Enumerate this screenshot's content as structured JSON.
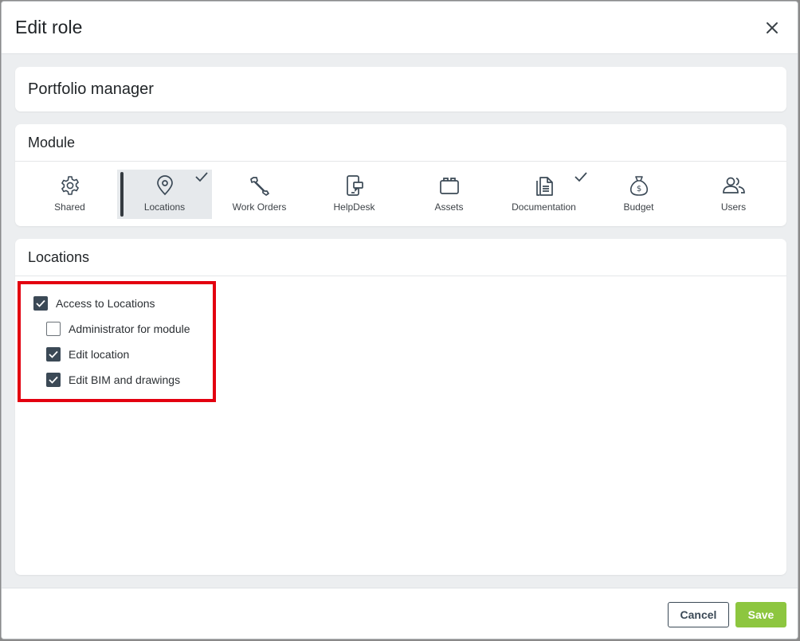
{
  "dialog": {
    "title": "Edit role",
    "close_icon": "close-icon"
  },
  "role": {
    "name": "Portfolio manager"
  },
  "module_section": {
    "title": "Module",
    "tabs": [
      {
        "label": "Shared",
        "icon": "gear-icon",
        "active": false,
        "has_access": false
      },
      {
        "label": "Locations",
        "icon": "location-pin-icon",
        "active": true,
        "has_access": true
      },
      {
        "label": "Work Orders",
        "icon": "wrench-icon",
        "active": false,
        "has_access": false
      },
      {
        "label": "HelpDesk",
        "icon": "phone-message-icon",
        "active": false,
        "has_access": false
      },
      {
        "label": "Assets",
        "icon": "assets-icon",
        "active": false,
        "has_access": false
      },
      {
        "label": "Documentation",
        "icon": "document-icon",
        "active": false,
        "has_access": true
      },
      {
        "label": "Budget",
        "icon": "money-bag-icon",
        "active": false,
        "has_access": false
      },
      {
        "label": "Users",
        "icon": "users-icon",
        "active": false,
        "has_access": false
      }
    ]
  },
  "locations_section": {
    "title": "Locations",
    "permissions": [
      {
        "label": "Access to Locations",
        "checked": true
      },
      {
        "label": "Administrator for module",
        "checked": false
      },
      {
        "label": "Edit location",
        "checked": true
      },
      {
        "label": "Edit BIM and drawings",
        "checked": true
      }
    ],
    "highlight_color": "#e3000f"
  },
  "footer": {
    "cancel_label": "Cancel",
    "save_label": "Save"
  },
  "colors": {
    "accent_dark": "#3b4956",
    "save_green": "#8dc63f"
  }
}
